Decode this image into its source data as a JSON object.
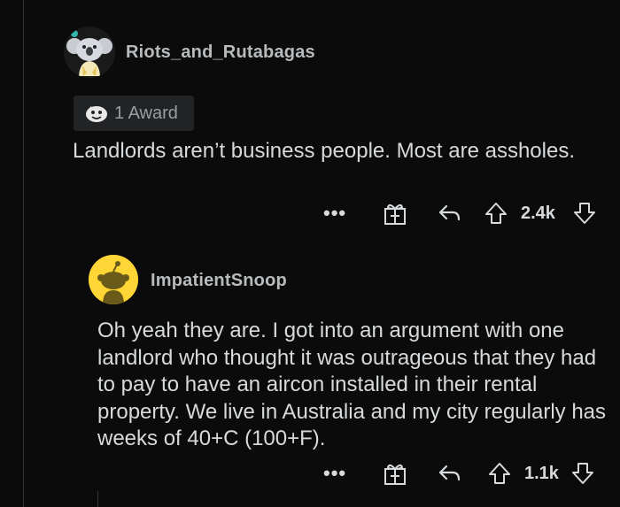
{
  "comments": [
    {
      "username": "Riots_and_Rutabagas",
      "award_label": "1 Award",
      "body": "Landlords aren’t business people. Most are assholes.",
      "score": "2.4k",
      "more_label": "•••"
    },
    {
      "username": "ImpatientSnoop",
      "body": "Oh yeah they are. I got into an argument with one landlord who thought it was outrageous that they had to pay to have an aircon installed in their rental property. We live in Australia and my city regularly has weeks of 40+C (100+F).",
      "score": "1.1k",
      "more_label": "•••"
    }
  ],
  "icons": {
    "more": "more-options-icon",
    "gift": "award-gift-icon",
    "reply": "reply-icon",
    "upvote": "upvote-icon",
    "downvote": "downvote-icon"
  },
  "colors": {
    "background": "#0b0b0b",
    "text": "#d7dadc",
    "username": "#b8bbbd",
    "award_bg": "#222325",
    "snoo_yellow": "#ffd635"
  }
}
